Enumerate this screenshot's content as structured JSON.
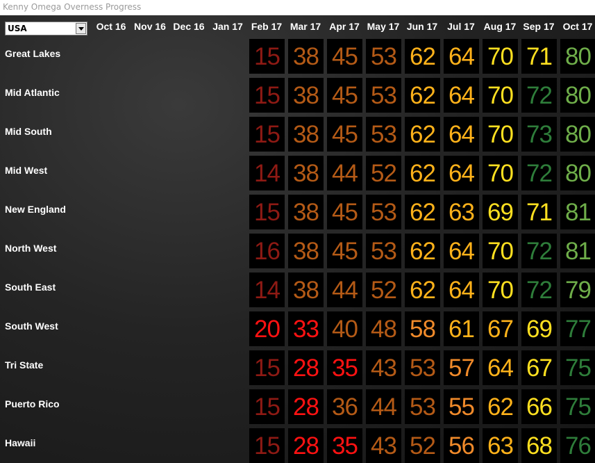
{
  "window": {
    "title": "Kenny Omega Overness Progress"
  },
  "region_select": {
    "value": "USA"
  },
  "months": [
    "Oct 16",
    "Nov 16",
    "Dec 16",
    "Jan 17",
    "Feb 17",
    "Mar 17",
    "Apr 17",
    "May 17",
    "Jun 17",
    "Jul 17",
    "Aug 17",
    "Sep 17",
    "Oct 17"
  ],
  "colors": {
    "darkred": "#8e1a14",
    "red": "#ff1212",
    "brown": "#b45a16",
    "orange": "#f08a2a",
    "amber": "#ffb21a",
    "yellow": "#ffe020",
    "darkgreen": "#2e7d3a",
    "green": "#6fae4a"
  },
  "rows": [
    {
      "label": "Great Lakes",
      "values": [
        "15",
        "38",
        "45",
        "53",
        "62",
        "64",
        "70",
        "71",
        "80"
      ],
      "colors": [
        "darkred",
        "brown",
        "brown",
        "brown",
        "amber",
        "amber",
        "yellow",
        "yellow",
        "green"
      ]
    },
    {
      "label": "Mid Atlantic",
      "values": [
        "15",
        "38",
        "45",
        "53",
        "62",
        "64",
        "70",
        "72",
        "80"
      ],
      "colors": [
        "darkred",
        "brown",
        "brown",
        "brown",
        "amber",
        "amber",
        "yellow",
        "darkgreen",
        "green"
      ]
    },
    {
      "label": "Mid South",
      "values": [
        "15",
        "38",
        "45",
        "53",
        "62",
        "64",
        "70",
        "73",
        "80"
      ],
      "colors": [
        "darkred",
        "brown",
        "brown",
        "brown",
        "amber",
        "amber",
        "yellow",
        "darkgreen",
        "green"
      ]
    },
    {
      "label": "Mid West",
      "values": [
        "14",
        "38",
        "44",
        "52",
        "62",
        "64",
        "70",
        "72",
        "80"
      ],
      "colors": [
        "darkred",
        "brown",
        "brown",
        "brown",
        "amber",
        "amber",
        "yellow",
        "darkgreen",
        "green"
      ]
    },
    {
      "label": "New England",
      "values": [
        "15",
        "38",
        "45",
        "53",
        "62",
        "63",
        "69",
        "71",
        "81"
      ],
      "colors": [
        "darkred",
        "brown",
        "brown",
        "brown",
        "amber",
        "amber",
        "yellow",
        "yellow",
        "green"
      ]
    },
    {
      "label": "North West",
      "values": [
        "16",
        "38",
        "45",
        "53",
        "62",
        "64",
        "70",
        "72",
        "81"
      ],
      "colors": [
        "darkred",
        "brown",
        "brown",
        "brown",
        "amber",
        "amber",
        "yellow",
        "darkgreen",
        "green"
      ]
    },
    {
      "label": "South East",
      "values": [
        "14",
        "38",
        "44",
        "52",
        "62",
        "64",
        "70",
        "72",
        "79"
      ],
      "colors": [
        "darkred",
        "brown",
        "brown",
        "brown",
        "amber",
        "amber",
        "yellow",
        "darkgreen",
        "green"
      ]
    },
    {
      "label": "South West",
      "values": [
        "20",
        "33",
        "40",
        "48",
        "58",
        "61",
        "67",
        "69",
        "77"
      ],
      "colors": [
        "red",
        "red",
        "brown",
        "brown",
        "orange",
        "amber",
        "amber",
        "yellow",
        "darkgreen"
      ]
    },
    {
      "label": "Tri State",
      "values": [
        "15",
        "28",
        "35",
        "43",
        "53",
        "57",
        "64",
        "67",
        "75"
      ],
      "colors": [
        "darkred",
        "red",
        "red",
        "brown",
        "brown",
        "orange",
        "amber",
        "yellow",
        "darkgreen"
      ]
    },
    {
      "label": "Puerto Rico",
      "values": [
        "15",
        "28",
        "36",
        "44",
        "53",
        "55",
        "62",
        "66",
        "75"
      ],
      "colors": [
        "darkred",
        "red",
        "brown",
        "brown",
        "brown",
        "orange",
        "amber",
        "yellow",
        "darkgreen"
      ]
    },
    {
      "label": "Hawaii",
      "values": [
        "15",
        "28",
        "35",
        "43",
        "52",
        "56",
        "63",
        "68",
        "76"
      ],
      "colors": [
        "darkred",
        "red",
        "red",
        "brown",
        "brown",
        "orange",
        "amber",
        "yellow",
        "darkgreen"
      ]
    }
  ]
}
